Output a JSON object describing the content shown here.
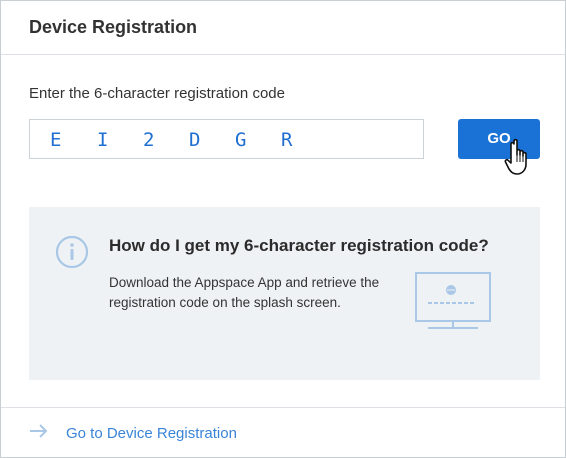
{
  "header": {
    "title": "Device Registration"
  },
  "registration": {
    "label": "Enter the 6-character registration code",
    "code_chars": [
      "E",
      "I",
      "2",
      "D",
      "G",
      "R"
    ],
    "go_label": "GO"
  },
  "help": {
    "icon": "info-icon",
    "title": "How do I get my 6-character registration code?",
    "body": "Download the Appspace App and retrieve the registration code on the splash screen.",
    "illustration": "screen-icon"
  },
  "footer": {
    "icon": "arrow-right-icon",
    "link_label": "Go to Device Registration"
  },
  "colors": {
    "accent": "#1a72d6",
    "link": "#3a84d8",
    "code_text": "#1f6fd1",
    "help_background": "#eff2f5",
    "icon_muted": "#a9c7e6"
  }
}
